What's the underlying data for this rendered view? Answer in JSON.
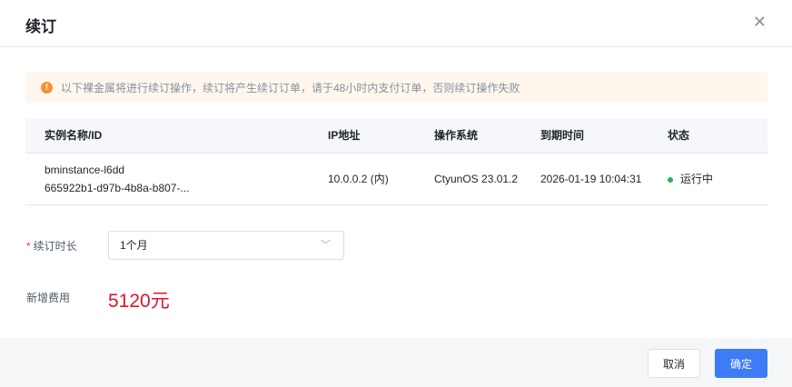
{
  "dialog": {
    "title": "续订",
    "close_icon": "close-icon"
  },
  "alert": {
    "text": "以下裸金属将进行续订操作，续订将产生续订订单，请于48小时内支付订单，否则续订操作失败",
    "icon": "!"
  },
  "table": {
    "headers": [
      "实例名称/ID",
      "IP地址",
      "操作系统",
      "到期时间",
      "状态"
    ],
    "rows": [
      {
        "name": "bminstance-l6dd",
        "id": "665922b1-d97b-4b8a-b807-...",
        "ip": "10.0.0.2 (内)",
        "os": "CtyunOS 23.01.2",
        "expire": "2026-01-19 10:04:31",
        "status": "运行中"
      }
    ]
  },
  "form": {
    "duration_label": "续订时长",
    "required_mark": "*",
    "duration_value": "1个月",
    "cost_label": "新增费用",
    "cost_value": "5120元"
  },
  "footer": {
    "cancel": "取消",
    "confirm": "确定"
  },
  "colors": {
    "primary": "#3d7cf5",
    "price": "#e0122d",
    "warning": "#f7912e",
    "running": "#22b35e"
  }
}
